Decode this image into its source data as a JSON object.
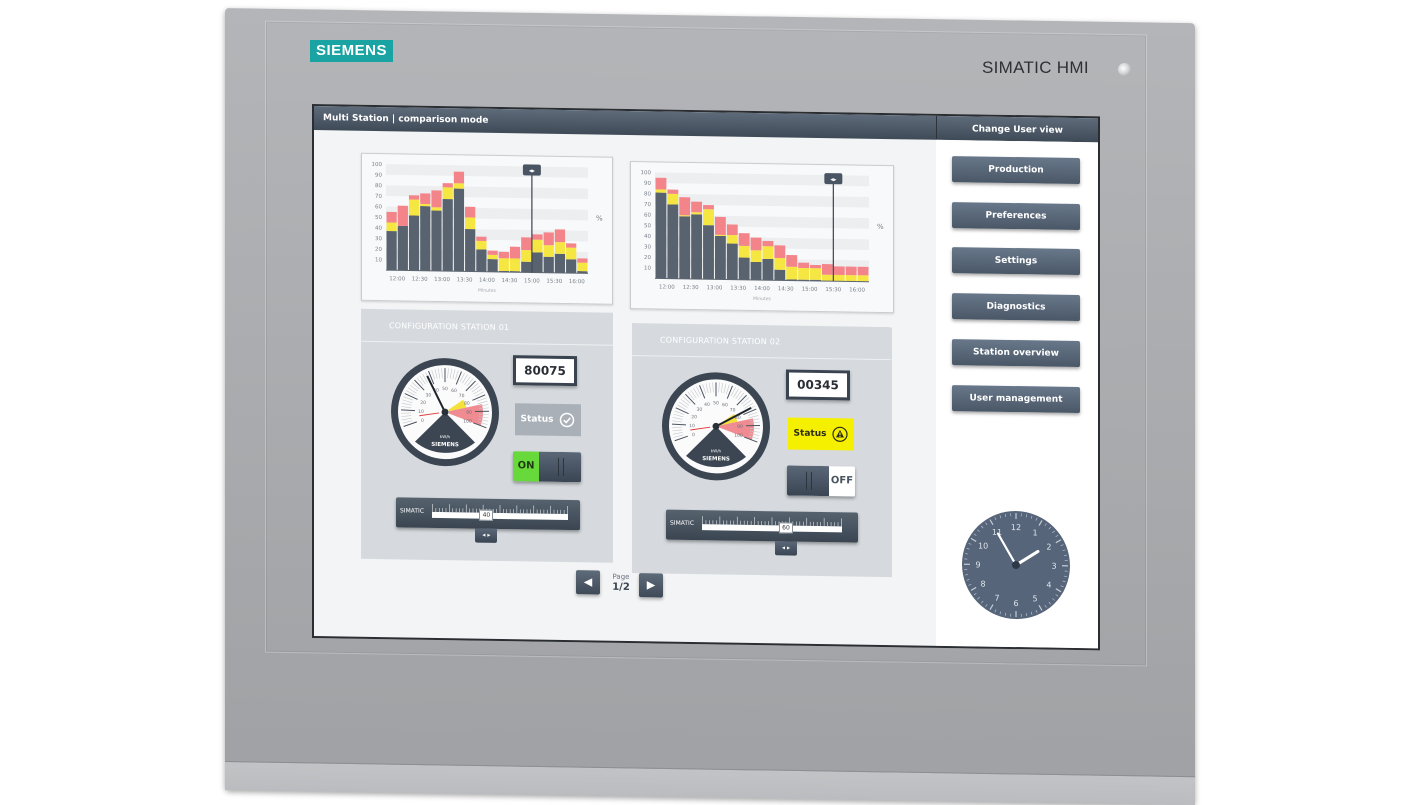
{
  "device": {
    "logo": "SIEMENS",
    "brand": "SIMATIC HMI",
    "logo_color": "#1aa3a3"
  },
  "screen": {
    "title": "Multi Station | comparison mode",
    "sidebar": {
      "header": "Change User view",
      "buttons": [
        {
          "label": "Production"
        },
        {
          "label": "Preferences"
        },
        {
          "label": "Settings"
        },
        {
          "label": "Diagnostics"
        },
        {
          "label": "Station overview"
        },
        {
          "label": "User management"
        }
      ],
      "clock": {
        "hour": 13,
        "minute": 55,
        "numerals": [
          "12",
          "1",
          "2",
          "3",
          "4",
          "5",
          "6",
          "7",
          "8",
          "9",
          "10",
          "11"
        ]
      }
    },
    "pager": {
      "label": "Page",
      "value": "1/2",
      "prev_icon": "triangle-left-icon",
      "next_icon": "triangle-right-icon"
    },
    "stations": [
      {
        "title": "CONFIGURATION STATION 01",
        "counter": "80075",
        "status": {
          "label": "Status",
          "icon": "check-circle-icon",
          "state": "ok",
          "color": "#a9b0b7"
        },
        "toggle": {
          "label": "ON",
          "state": "on"
        },
        "gauge": {
          "unit": "kW/h",
          "brand": "SIEMENS",
          "value": 38,
          "min": 0,
          "max": 100,
          "ticks": [
            "0",
            "10",
            "20",
            "30",
            "40",
            "50",
            "60",
            "70",
            "80",
            "90",
            "100"
          ],
          "warn_from": 75,
          "alarm_from": 85
        },
        "slider": {
          "label": "SIMATIC",
          "value": 40,
          "min": 0,
          "max": 100
        }
      },
      {
        "title": "CONFIGURATION STATION 02",
        "counter": "00345",
        "status": {
          "label": "Status",
          "icon": "warning-icon",
          "state": "warning",
          "color": "#f5ef00"
        },
        "toggle": {
          "label": "OFF",
          "state": "off"
        },
        "gauge": {
          "unit": "kW/h",
          "brand": "SIEMENS",
          "value": 78,
          "min": 0,
          "max": 100,
          "ticks": [
            "0",
            "10",
            "20",
            "30",
            "40",
            "50",
            "60",
            "70",
            "80",
            "90",
            "100"
          ],
          "warn_from": 75,
          "alarm_from": 85
        },
        "slider": {
          "label": "SIMATIC",
          "value": 60,
          "min": 0,
          "max": 100
        }
      }
    ]
  },
  "chart_data": [
    {
      "type": "bar",
      "stacked": true,
      "title": "",
      "xlabel": "Minutes",
      "ylabel": "%",
      "ylim": [
        0,
        100
      ],
      "yticks": [
        10,
        20,
        30,
        40,
        50,
        60,
        70,
        80,
        90,
        100
      ],
      "categories": [
        "12:00",
        "12:30",
        "13:00",
        "13:30",
        "14:00",
        "14:30",
        "15:00",
        "15:30",
        "16:00"
      ],
      "cursor_at": "15:00",
      "cursor_icon": "drag-handle-icon",
      "colors": {
        "base": "#59636f",
        "yellow": "#f6e641",
        "red": "#f3848a"
      },
      "series": [
        {
          "name": "base",
          "values": [
            37,
            42,
            52,
            61,
            57,
            68,
            78,
            40,
            21,
            12,
            1,
            1,
            10,
            19,
            15,
            18,
            13,
            2
          ]
        },
        {
          "name": "yellow",
          "values": [
            8,
            0,
            15,
            2,
            3,
            11,
            5,
            11,
            8,
            4,
            12,
            12,
            11,
            12,
            11,
            11,
            11,
            8
          ]
        },
        {
          "name": "red",
          "values": [
            10,
            19,
            4,
            10,
            16,
            4,
            11,
            10,
            4,
            4,
            6,
            11,
            12,
            5,
            12,
            12,
            4,
            4
          ]
        }
      ]
    },
    {
      "type": "bar",
      "stacked": true,
      "title": "",
      "xlabel": "Minutes",
      "ylabel": "%",
      "ylim": [
        0,
        100
      ],
      "yticks": [
        10,
        20,
        30,
        40,
        50,
        60,
        70,
        80,
        90,
        100
      ],
      "categories": [
        "12:00",
        "12:30",
        "13:00",
        "13:30",
        "14:00",
        "14:30",
        "15:00",
        "15:30",
        "16:00"
      ],
      "cursor_at": "15:30",
      "cursor_icon": "drag-handle-icon",
      "colors": {
        "base": "#59636f",
        "yellow": "#f6e641",
        "red": "#f3848a"
      },
      "series": [
        {
          "name": "base",
          "values": [
            81,
            70,
            59,
            61,
            51,
            41,
            34,
            21,
            17,
            20,
            10,
            1,
            1,
            1,
            0,
            0,
            0,
            0
          ]
        },
        {
          "name": "yellow",
          "values": [
            3,
            10,
            1,
            2,
            15,
            1,
            8,
            11,
            11,
            12,
            11,
            12,
            11,
            11,
            6,
            6,
            6,
            6
          ]
        },
        {
          "name": "red",
          "values": [
            11,
            4,
            17,
            10,
            4,
            17,
            10,
            12,
            12,
            5,
            12,
            11,
            5,
            3,
            10,
            8,
            8,
            8
          ]
        }
      ]
    }
  ]
}
